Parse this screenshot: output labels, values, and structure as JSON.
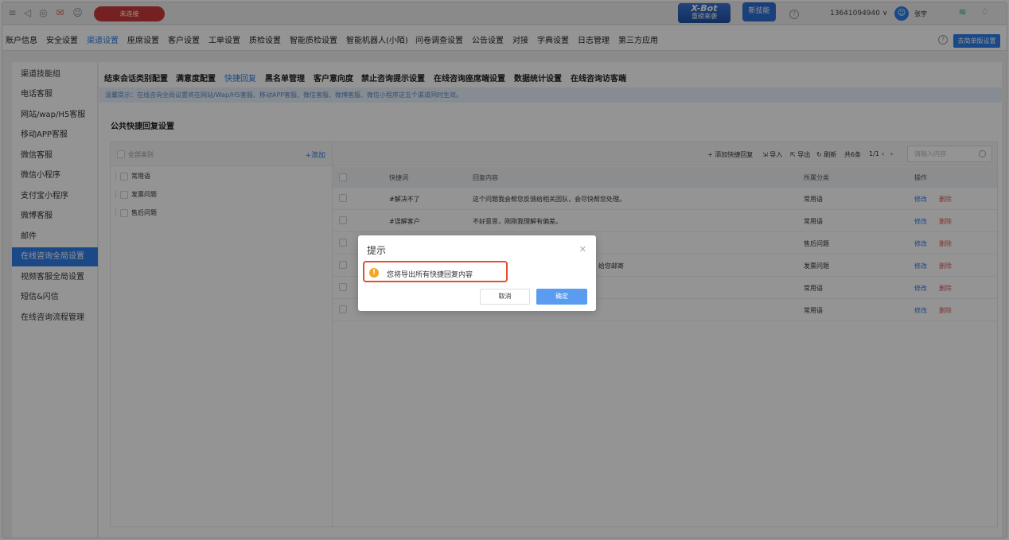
{
  "topbar": {
    "connect_btn": "未连接",
    "xbot_line1": "X-Bot",
    "xbot_line2": "重磅来袭",
    "new_skill": "新技能",
    "phone": "13641094940 ∨",
    "user": "张宇"
  },
  "nav": {
    "items": [
      "账户信息",
      "安全设置",
      "渠道设置",
      "座席设置",
      "客户设置",
      "工单设置",
      "质检设置",
      "智能质检设置",
      "智能机器人(小陌)",
      "问卷调查设置",
      "公告设置",
      "对接",
      "字典设置",
      "日志管理",
      "第三方应用"
    ],
    "simple_btn": "去简单版设置"
  },
  "sidebar": {
    "items": [
      "渠道技能组",
      "电话客服",
      "网站/wap/H5客服",
      "移动APP客服",
      "微信客服",
      "微信小程序",
      "支付宝小程序",
      "微博客服",
      "邮件",
      "在线咨询全局设置",
      "视频客服全局设置",
      "短信&闪信",
      "在线咨询流程管理"
    ]
  },
  "subtabs": [
    "结束会话类别配置",
    "满意度配置",
    "快捷回复",
    "黑名单管理",
    "客户意向度",
    "禁止咨询提示设置",
    "在线咨询座席端设置",
    "数据统计设置",
    "在线咨询访客端"
  ],
  "tip": "温馨提示：在线咨询全局设置将在网站/Wap/H5客服、移动APP客服、微信客服、微博客服、微信小程序这五个渠道同时生效。",
  "section_title": "公共快捷回复设置",
  "categories": {
    "all_label": "全部类别",
    "add": "+添加",
    "items": [
      "常用语",
      "发票问题",
      "售后问题"
    ]
  },
  "toolbar": {
    "add_reply": "+ 添加快捷回复",
    "import": "导入",
    "export": "导出",
    "refresh": "刷新",
    "count": "共6条",
    "page": "1/1",
    "search_placeholder": "请输入内容"
  },
  "table": {
    "headers": [
      "快捷词",
      "回复内容",
      "所属分类",
      "操作"
    ],
    "rows": [
      {
        "keyword": "#解决不了",
        "content": "这个问题我会帮您反馈给相关团队，会尽快帮您处理。",
        "category": "常用语",
        "edit": "修改",
        "del": "删除"
      },
      {
        "keyword": "#误解客户",
        "content": "不好意思，刚刚我理解有偏差。",
        "category": "常用语",
        "edit": "修改",
        "del": "删除"
      },
      {
        "keyword": "",
        "content": "",
        "category": "售后问题",
        "edit": "修改",
        "del": "删除"
      },
      {
        "keyword": "",
        "content": "给您邮寄",
        "category": "发票问题",
        "edit": "修改",
        "del": "删除"
      },
      {
        "keyword": "",
        "content": "",
        "category": "常用语",
        "edit": "修改",
        "del": "删除"
      },
      {
        "keyword": "",
        "content": "",
        "category": "常用语",
        "edit": "修改",
        "del": "删除"
      }
    ]
  },
  "dialog": {
    "title": "提示",
    "message": "您将导出所有快捷回复内容",
    "cancel": "取消",
    "ok": "确定"
  },
  "colors": {
    "accent": "#2f7ee8",
    "danger": "#e0595b",
    "warn": "#f5a623",
    "highlight": "#e2502c"
  }
}
